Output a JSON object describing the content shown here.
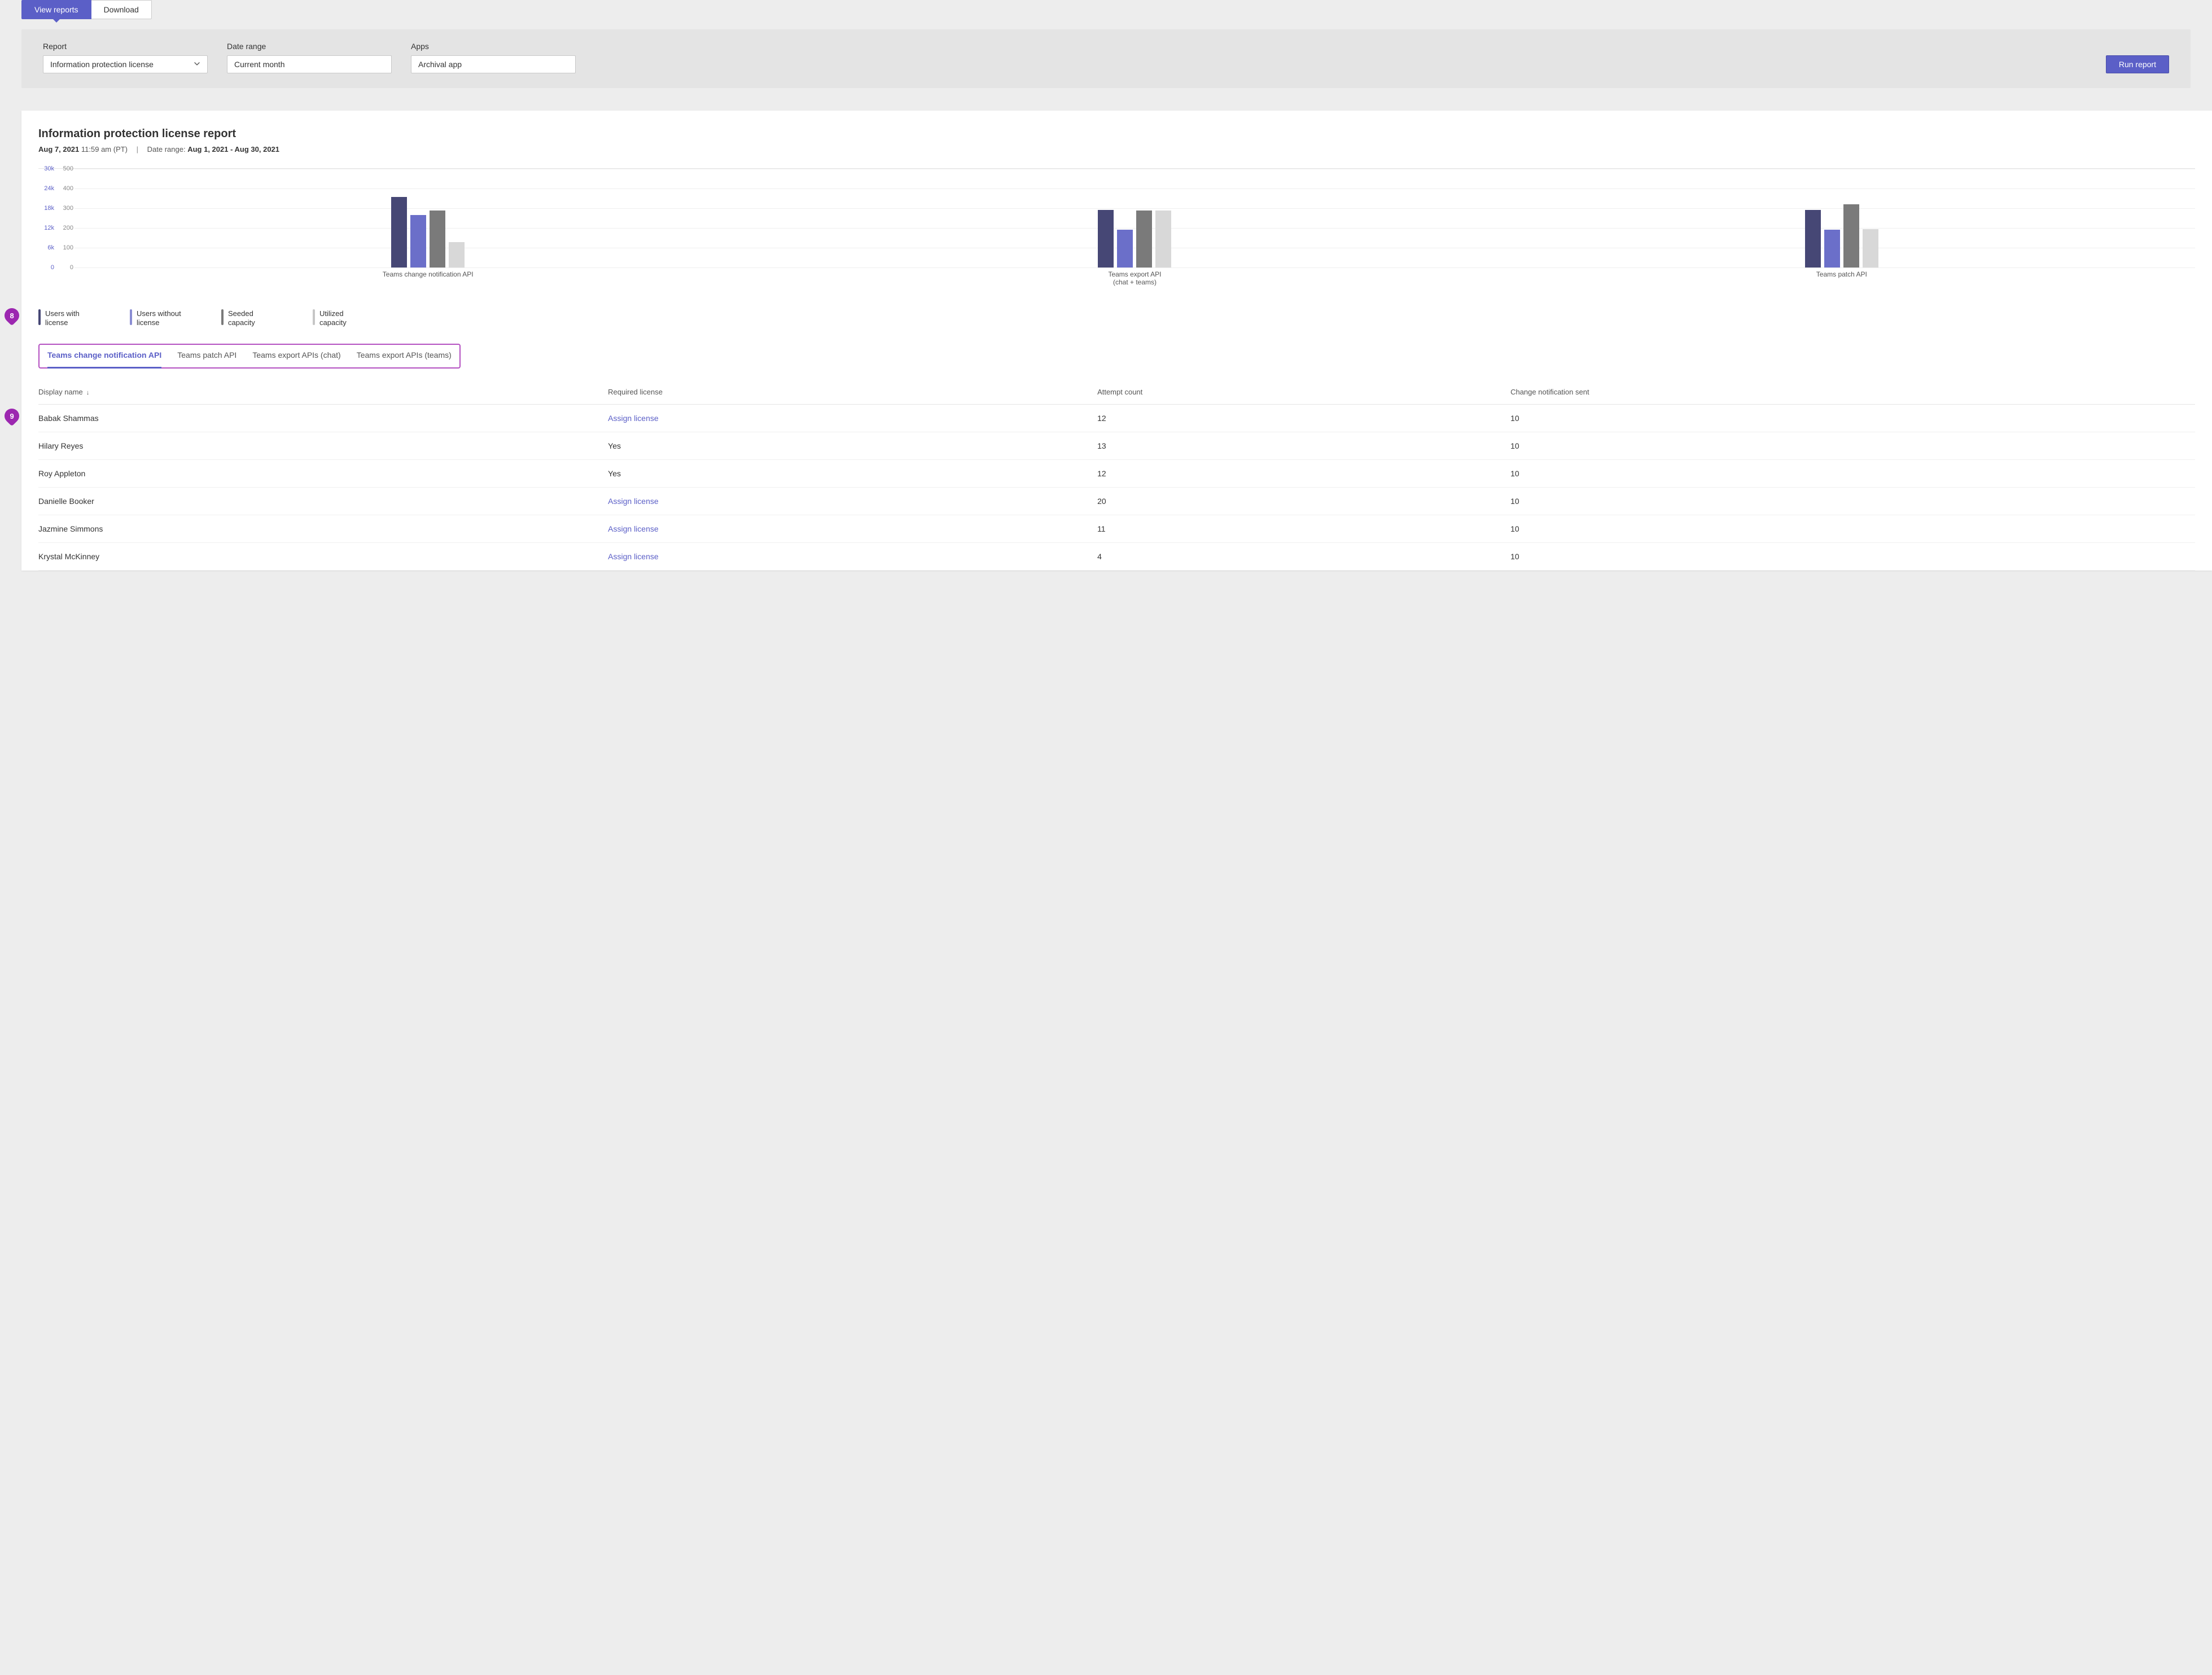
{
  "top_tabs": {
    "view_reports": "View reports",
    "download": "Download"
  },
  "filters": {
    "report_label": "Report",
    "report_value": "Information protection license",
    "date_label": "Date range",
    "date_value": "Current month",
    "apps_label": "Apps",
    "apps_value": "Archival app",
    "run_button": "Run report"
  },
  "report": {
    "title": "Information protection license report",
    "timestamp_date": "Aug 7, 2021",
    "timestamp_time": "11:59 am (PT)",
    "date_range_prefix": "Date range: ",
    "date_range_value": "Aug 1, 2021 - Aug 30, 2021"
  },
  "chart_data": {
    "type": "bar",
    "y_primary": {
      "label": "",
      "ticks": [
        "30k",
        "24k",
        "18k",
        "12k",
        "6k",
        "0"
      ],
      "max": 30000
    },
    "y_secondary": {
      "label": "",
      "ticks": [
        "500",
        "400",
        "300",
        "200",
        "100",
        "0"
      ],
      "max": 500
    },
    "categories": [
      {
        "label": "Teams change notification API",
        "sublabel": ""
      },
      {
        "label": "Teams export API",
        "sublabel": "(chat + teams)"
      },
      {
        "label": "Teams patch API",
        "sublabel": ""
      }
    ],
    "series": [
      {
        "name": "Users with license",
        "axis": "primary",
        "color": "#464775",
        "values": [
          21500,
          17500,
          17500
        ]
      },
      {
        "name": "Users without license",
        "axis": "primary",
        "color": "#6b6fc9",
        "values": [
          16000,
          11500,
          11500
        ]
      },
      {
        "name": "Seeded capacity",
        "axis": "secondary",
        "color": "#7a7a7a",
        "values": [
          290,
          290,
          320
        ]
      },
      {
        "name": "Utilized capacity",
        "axis": "secondary",
        "color": "#d8d8d8",
        "values": [
          130,
          290,
          195
        ]
      }
    ],
    "legend": [
      "Users with license",
      "Users without license",
      "Seeded capacity",
      "Utilized capacity"
    ]
  },
  "callouts": {
    "eight": "8",
    "nine": "9"
  },
  "subtabs": [
    "Teams change notification API",
    "Teams patch API",
    "Teams export APIs (chat)",
    "Teams export APIs (teams)"
  ],
  "table": {
    "columns": [
      "Display name",
      "Required license",
      "Attempt count",
      "Change notification sent"
    ],
    "sort_col": 0,
    "assign_license_label": "Assign license",
    "rows": [
      {
        "name": "Babak Shammas",
        "license": null,
        "attempt": "12",
        "sent": "10"
      },
      {
        "name": "Hilary Reyes",
        "license": "Yes",
        "attempt": "13",
        "sent": "10"
      },
      {
        "name": "Roy Appleton",
        "license": "Yes",
        "attempt": "12",
        "sent": "10"
      },
      {
        "name": "Danielle Booker",
        "license": null,
        "attempt": "20",
        "sent": "10"
      },
      {
        "name": "Jazmine Simmons",
        "license": null,
        "attempt": "11",
        "sent": "10"
      },
      {
        "name": "Krystal McKinney",
        "license": null,
        "attempt": "4",
        "sent": "10"
      }
    ]
  }
}
